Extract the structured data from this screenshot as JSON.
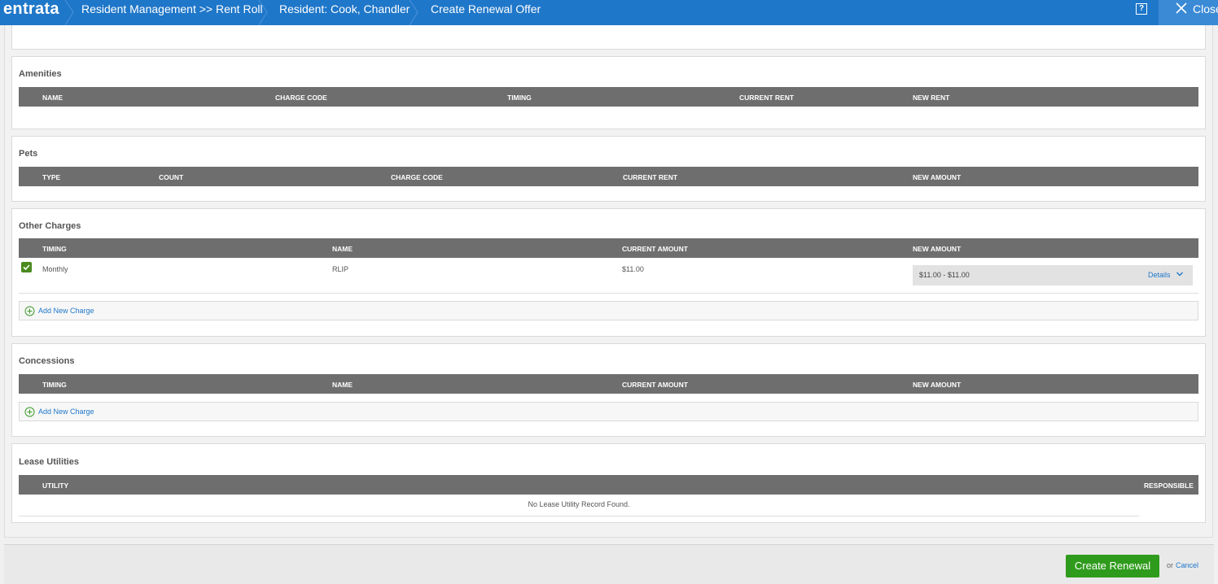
{
  "header": {
    "logo": "entrata",
    "breadcrumbs": [
      "Resident Management >> Rent Roll",
      "Resident: Cook, Chandler",
      "Create Renewal Offer"
    ],
    "help_icon": "?",
    "close_label": "Close"
  },
  "amenities": {
    "title": "Amenities",
    "columns": [
      "NAME",
      "CHARGE CODE",
      "TIMING",
      "CURRENT RENT",
      "NEW RENT"
    ]
  },
  "pets": {
    "title": "Pets",
    "columns": [
      "TYPE",
      "COUNT",
      "CHARGE CODE",
      "CURRENT RENT",
      "NEW AMOUNT"
    ]
  },
  "other_charges": {
    "title": "Other Charges",
    "columns": [
      "TIMING",
      "NAME",
      "CURRENT AMOUNT",
      "NEW AMOUNT"
    ],
    "rows": [
      {
        "checked": true,
        "timing": "Monthly",
        "name": "RLIP",
        "current_amount": "$11.00",
        "new_amount": "$11.00 - $11.00",
        "details_label": "Details"
      }
    ],
    "add_label": "Add New Charge"
  },
  "concessions": {
    "title": "Concessions",
    "columns": [
      "TIMING",
      "NAME",
      "CURRENT AMOUNT",
      "NEW AMOUNT"
    ],
    "add_label": "Add New Charge"
  },
  "lease_utilities": {
    "title": "Lease Utilities",
    "columns": [
      "UTILITY",
      "RESPONSIBLE"
    ],
    "empty_message": "No Lease Utility Record Found."
  },
  "footer": {
    "create_label": "Create Renewal",
    "or_label": "or",
    "cancel_label": "Cancel"
  },
  "colors": {
    "topbar": "#1f77c9",
    "table_header": "#6e6e6e",
    "primary_button": "#2f9b1c",
    "link": "#1f77c9"
  }
}
